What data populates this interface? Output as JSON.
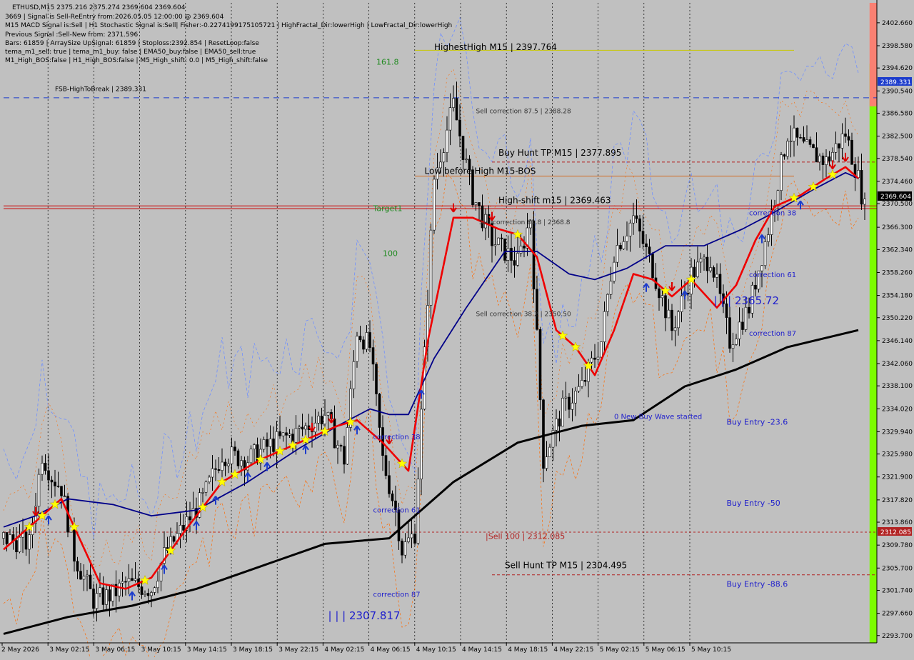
{
  "header": {
    "symbol": "ETHUSD,M15  2375.216 2375.274 2369.604 2369.604",
    "lines": [
      "3669 | Signal is Sell-ReEntry from:2026.05.05 12:00:00 @ 2369.604",
      "M15 MACD Signal is:Sell | H1 Stochastic Signal is:Sell| Fisher:-0.2274199175105721 | HighFractal_Dir:lowerHigh | LowFractal_Dir:lowerHigh",
      "Previous Signal :Sell-New from: 2371.596",
      "Bars: 61859 | ArraySize UpSignal: 61859 | Stoploss:2392.854 | ResetLoop:false",
      "tema_m1_sell: true | tema_m1_buy: false | EMA50_buy:false | EMA50_sell:true",
      "M1_High_BOS:false | H1_High_BOS:false | M5_High_shift: 0.0 | M5_High_shift:false"
    ]
  },
  "colors": {
    "background": "#c0c0c0",
    "grid": "#000000",
    "bull": "#ffffff",
    "bear": "#000000",
    "ema_fast": "#ee0000",
    "ema_mid": "#000088",
    "ema_slow": "#000000",
    "green_zone": "#7cfc00",
    "red_zone": "#fa8072",
    "blue_label": "#2020cc",
    "current_price_tag": "#000000",
    "blue_tag": "#1c3ccc",
    "red_tag": "#b22222"
  },
  "chart_data": {
    "type": "candlestick",
    "symbol": "ETHUSD",
    "timeframe": "M15",
    "ylim": [
      2292.4,
      2406.2
    ],
    "y_ticks": [
      "2402.660",
      "2398.580",
      "2394.620",
      "2390.540",
      "2386.580",
      "2382.500",
      "2378.540",
      "2374.460",
      "2370.500",
      "2366.300",
      "2362.340",
      "2358.260",
      "2354.180",
      "2350.220",
      "2346.140",
      "2342.060",
      "2338.100",
      "2334.020",
      "2329.940",
      "2325.980",
      "2321.900",
      "2317.820",
      "2313.860",
      "2309.780",
      "2305.700",
      "2301.740",
      "2297.660",
      "2293.700"
    ],
    "x_labels": [
      "2 May 2026",
      "3 May 02:15",
      "3 May 06:15",
      "3 May 10:15",
      "3 May 14:15",
      "3 May 18:15",
      "3 May 22:15",
      "4 May 02:15",
      "4 May 06:15",
      "4 May 10:15",
      "4 May 14:15",
      "4 May 18:15",
      "4 May 22:15",
      "5 May 02:15",
      "5 May 06:15",
      "5 May 10:15"
    ],
    "price_tags": {
      "current": "2369.604",
      "fsb": "2389.331",
      "sell_100": "2312.085"
    },
    "ohlc_anchors": [
      {
        "bar": 0,
        "close": 2311
      },
      {
        "bar": 8,
        "close": 2310
      },
      {
        "bar": 12,
        "close": 2326
      },
      {
        "bar": 15,
        "close": 2322
      },
      {
        "bar": 18,
        "close": 2320
      },
      {
        "bar": 22,
        "close": 2308
      },
      {
        "bar": 28,
        "close": 2300
      },
      {
        "bar": 34,
        "close": 2301
      },
      {
        "bar": 38,
        "close": 2303
      },
      {
        "bar": 46,
        "close": 2302
      },
      {
        "bar": 50,
        "close": 2308
      },
      {
        "bar": 56,
        "close": 2313
      },
      {
        "bar": 62,
        "close": 2318
      },
      {
        "bar": 68,
        "close": 2326
      },
      {
        "bar": 76,
        "close": 2325
      },
      {
        "bar": 84,
        "close": 2328
      },
      {
        "bar": 92,
        "close": 2330
      },
      {
        "bar": 100,
        "close": 2333
      },
      {
        "bar": 106,
        "close": 2325
      },
      {
        "bar": 110,
        "close": 2348
      },
      {
        "bar": 114,
        "close": 2345
      },
      {
        "bar": 118,
        "close": 2325
      },
      {
        "bar": 122,
        "close": 2316
      },
      {
        "bar": 124,
        "close": 2309
      },
      {
        "bar": 128,
        "close": 2312
      },
      {
        "bar": 134,
        "close": 2375
      },
      {
        "bar": 140,
        "close": 2388
      },
      {
        "bar": 146,
        "close": 2372
      },
      {
        "bar": 152,
        "close": 2364
      },
      {
        "bar": 160,
        "close": 2360
      },
      {
        "bar": 164,
        "close": 2368
      },
      {
        "bar": 168,
        "close": 2325
      },
      {
        "bar": 174,
        "close": 2334
      },
      {
        "bar": 180,
        "close": 2338
      },
      {
        "bar": 186,
        "close": 2346
      },
      {
        "bar": 190,
        "close": 2362
      },
      {
        "bar": 196,
        "close": 2368
      },
      {
        "bar": 202,
        "close": 2359
      },
      {
        "bar": 208,
        "close": 2348
      },
      {
        "bar": 214,
        "close": 2358
      },
      {
        "bar": 220,
        "close": 2361
      },
      {
        "bar": 226,
        "close": 2346
      },
      {
        "bar": 232,
        "close": 2352
      },
      {
        "bar": 238,
        "close": 2366
      },
      {
        "bar": 244,
        "close": 2383
      },
      {
        "bar": 250,
        "close": 2380
      },
      {
        "bar": 256,
        "close": 2378
      },
      {
        "bar": 262,
        "close": 2383
      },
      {
        "bar": 266,
        "close": 2375
      },
      {
        "bar": 268,
        "close": 2369.604
      }
    ],
    "ema_fast": [
      {
        "bar": 0,
        "v": 2309
      },
      {
        "bar": 10,
        "v": 2314
      },
      {
        "bar": 18,
        "v": 2318
      },
      {
        "bar": 30,
        "v": 2303
      },
      {
        "bar": 38,
        "v": 2302
      },
      {
        "bar": 46,
        "v": 2304
      },
      {
        "bar": 56,
        "v": 2312
      },
      {
        "bar": 68,
        "v": 2321
      },
      {
        "bar": 80,
        "v": 2325
      },
      {
        "bar": 92,
        "v": 2328
      },
      {
        "bar": 104,
        "v": 2331
      },
      {
        "bar": 110,
        "v": 2332
      },
      {
        "bar": 118,
        "v": 2328
      },
      {
        "bar": 126,
        "v": 2323
      },
      {
        "bar": 132,
        "v": 2346
      },
      {
        "bar": 140,
        "v": 2368
      },
      {
        "bar": 146,
        "v": 2368
      },
      {
        "bar": 154,
        "v": 2366
      },
      {
        "bar": 160,
        "v": 2365
      },
      {
        "bar": 166,
        "v": 2361
      },
      {
        "bar": 172,
        "v": 2348
      },
      {
        "bar": 178,
        "v": 2345
      },
      {
        "bar": 184,
        "v": 2340
      },
      {
        "bar": 190,
        "v": 2348
      },
      {
        "bar": 196,
        "v": 2358
      },
      {
        "bar": 202,
        "v": 2357
      },
      {
        "bar": 208,
        "v": 2354
      },
      {
        "bar": 214,
        "v": 2357
      },
      {
        "bar": 222,
        "v": 2352
      },
      {
        "bar": 228,
        "v": 2356
      },
      {
        "bar": 234,
        "v": 2364
      },
      {
        "bar": 240,
        "v": 2370
      },
      {
        "bar": 248,
        "v": 2372
      },
      {
        "bar": 256,
        "v": 2375
      },
      {
        "bar": 262,
        "v": 2377
      },
      {
        "bar": 266,
        "v": 2375
      }
    ],
    "ema_mid": [
      {
        "bar": 0,
        "v": 2313
      },
      {
        "bar": 10,
        "v": 2315
      },
      {
        "bar": 20,
        "v": 2318
      },
      {
        "bar": 34,
        "v": 2317
      },
      {
        "bar": 46,
        "v": 2315
      },
      {
        "bar": 60,
        "v": 2316
      },
      {
        "bar": 76,
        "v": 2321
      },
      {
        "bar": 92,
        "v": 2327
      },
      {
        "bar": 104,
        "v": 2331
      },
      {
        "bar": 114,
        "v": 2334
      },
      {
        "bar": 120,
        "v": 2333
      },
      {
        "bar": 126,
        "v": 2333
      },
      {
        "bar": 134,
        "v": 2343
      },
      {
        "bar": 144,
        "v": 2352
      },
      {
        "bar": 156,
        "v": 2362
      },
      {
        "bar": 166,
        "v": 2362
      },
      {
        "bar": 176,
        "v": 2358
      },
      {
        "bar": 184,
        "v": 2357
      },
      {
        "bar": 194,
        "v": 2359
      },
      {
        "bar": 206,
        "v": 2363
      },
      {
        "bar": 218,
        "v": 2363
      },
      {
        "bar": 230,
        "v": 2366
      },
      {
        "bar": 240,
        "v": 2369
      },
      {
        "bar": 252,
        "v": 2373
      },
      {
        "bar": 262,
        "v": 2376
      },
      {
        "bar": 266,
        "v": 2375
      }
    ],
    "ema_slow": [
      {
        "bar": 0,
        "v": 2294
      },
      {
        "bar": 20,
        "v": 2297
      },
      {
        "bar": 40,
        "v": 2299
      },
      {
        "bar": 60,
        "v": 2302
      },
      {
        "bar": 80,
        "v": 2306
      },
      {
        "bar": 100,
        "v": 2310
      },
      {
        "bar": 120,
        "v": 2311
      },
      {
        "bar": 140,
        "v": 2321
      },
      {
        "bar": 160,
        "v": 2328
      },
      {
        "bar": 180,
        "v": 2331
      },
      {
        "bar": 196,
        "v": 2332
      },
      {
        "bar": 212,
        "v": 2338
      },
      {
        "bar": 228,
        "v": 2341
      },
      {
        "bar": 244,
        "v": 2345
      },
      {
        "bar": 266,
        "v": 2348
      }
    ],
    "hlines": [
      {
        "name": "fsb-line",
        "y": 2389.331,
        "color": "#1c3ccc",
        "dash": "8,6",
        "from": 0,
        "to": 275
      },
      {
        "name": "current-price-line",
        "y": 2369.604,
        "color": "#cc0000",
        "dash": "",
        "from": 0,
        "to": 275
      },
      {
        "name": "current-price-line-2",
        "y": 2370.1,
        "color": "#cc0000",
        "dash": "",
        "from": 0,
        "to": 275
      },
      {
        "name": "sell-100-line",
        "y": 2312.085,
        "color": "#b22222",
        "dash": "3,3",
        "from": 0,
        "to": 275
      },
      {
        "name": "buy-hunt-line",
        "y": 2377.895,
        "color": "#b22222",
        "dash": "4,3",
        "from": 152,
        "to": 275
      },
      {
        "name": "sell-hunt-line",
        "y": 2304.495,
        "color": "#b22222",
        "dash": "4,3",
        "from": 152,
        "to": 275
      },
      {
        "name": "low-before-high-line",
        "y": 2375.4,
        "color": "#d2691e",
        "dash": "",
        "from": 128,
        "to": 246
      },
      {
        "name": "highest-high-line",
        "y": 2397.764,
        "color": "#c8c800",
        "dash": "",
        "from": 128,
        "to": 246
      }
    ],
    "zones": [
      {
        "name": "green-zone-left",
        "color": "#7cfc00",
        "x0": 154,
        "x1": 170,
        "y0": 2292.4,
        "y1": 2395.4
      },
      {
        "name": "red-zone-top",
        "color": "#fa8072",
        "x0": 154,
        "x1": 170,
        "y0": 2387.8,
        "y1": 2406.2
      },
      {
        "name": "green-zone-right",
        "color": "#7cfc00",
        "x0": 221,
        "x1": 239,
        "y0": 2349.2,
        "y1": 2406.2
      },
      {
        "name": "red-zone-bottom",
        "color": "#fa8072",
        "x0": 221,
        "x1": 239,
        "y0": 2292.4,
        "y1": 2349.2
      }
    ],
    "annotations": [
      {
        "name": "highest-high-label",
        "text": "HighestHigh   M15 | 2397.764",
        "bar": 134,
        "y": 2397.8,
        "color": "#000000",
        "size": 12
      },
      {
        "name": "fsb-label",
        "text": "FSB-HighToBreak | 2389.331",
        "bar": 16,
        "y": 2390.5,
        "color": "#000000",
        "size": 9
      },
      {
        "name": "sell-correction-875",
        "text": "Sell correction 87.5 | 2388.28",
        "bar": 147,
        "y": 2386.6,
        "color": "#333333",
        "size": 9
      },
      {
        "name": "buy-hunt-label",
        "text": "Buy Hunt  TP M15 | 2377.895",
        "bar": 154,
        "y": 2379.0,
        "color": "#000000",
        "size": 12
      },
      {
        "name": "low-before-high-label",
        "text": "Low before High   M15-BOS",
        "bar": 131,
        "y": 2375.8,
        "color": "#000000",
        "size": 12
      },
      {
        "name": "high-shift-label",
        "text": "High-shift m15 | 2369.463",
        "bar": 154,
        "y": 2370.6,
        "color": "#000000",
        "size": 12
      },
      {
        "name": "sell-correction-618",
        "text": "Sell correction 61.8 | 2368.8",
        "bar": 148,
        "y": 2366.8,
        "color": "#333333",
        "size": 9
      },
      {
        "name": "sell-correction-382",
        "text": "Sell correction 38.2 | 2350.50",
        "bar": 147,
        "y": 2350.5,
        "color": "#333333",
        "size": 9
      },
      {
        "name": "sell-100-label",
        "text": "|Sell 100 | 2312.085",
        "bar": 150,
        "y": 2310.9,
        "color": "#b22222",
        "size": 11
      },
      {
        "name": "sell-hunt-label",
        "text": "Sell Hunt  TP M15 | 2304.495",
        "bar": 156,
        "y": 2305.7,
        "color": "#000000",
        "size": 12
      },
      {
        "name": "target-label",
        "text": "Target1",
        "bar": 115,
        "y": 2369.2,
        "color": "#228b22",
        "size": 11
      },
      {
        "name": "fib-1618-label",
        "text": "161.8",
        "bar": 116,
        "y": 2395.2,
        "color": "#228b22",
        "size": 11
      },
      {
        "name": "fib-100-label",
        "text": "100",
        "bar": 118,
        "y": 2361.2,
        "color": "#228b22",
        "size": 11
      },
      {
        "name": "correction-38-a",
        "text": "correction 38",
        "bar": 115,
        "y": 2328.6,
        "color": "#2020cc",
        "size": 10
      },
      {
        "name": "correction-61-a",
        "text": "correction 61",
        "bar": 115,
        "y": 2315.6,
        "color": "#2020cc",
        "size": 10
      },
      {
        "name": "correction-87-a",
        "text": "correction 87",
        "bar": 115,
        "y": 2300.6,
        "color": "#2020cc",
        "size": 10
      },
      {
        "name": "level-2307817",
        "text": "| | | 2307.817",
        "bar": 101,
        "y": 2296.6,
        "color": "#2020cc",
        "size": 15
      },
      {
        "name": "correction-38-b",
        "text": "correction 38",
        "bar": 232,
        "y": 2368.4,
        "color": "#2020cc",
        "size": 10
      },
      {
        "name": "correction-61-b",
        "text": "correction 61",
        "bar": 232,
        "y": 2357.4,
        "color": "#2020cc",
        "size": 10
      },
      {
        "name": "correction-87-b",
        "text": "correction 87",
        "bar": 232,
        "y": 2347.0,
        "color": "#2020cc",
        "size": 10
      },
      {
        "name": "level-236572",
        "text": "| | | 2365.72",
        "bar": 221,
        "y": 2352.6,
        "color": "#2020cc",
        "size": 15
      },
      {
        "name": "new-buy-wave",
        "text": "0 New Buy Wave started",
        "bar": 190,
        "y": 2332.2,
        "color": "#2020cc",
        "size": 10
      },
      {
        "name": "buy-entry-236",
        "text": "Buy Entry -23.6",
        "bar": 225,
        "y": 2331.2,
        "color": "#2020cc",
        "size": 11
      },
      {
        "name": "buy-entry-50",
        "text": "Buy Entry -50",
        "bar": 225,
        "y": 2316.8,
        "color": "#2020cc",
        "size": 11
      },
      {
        "name": "buy-entry-886",
        "text": "Buy Entry -88.6",
        "bar": 225,
        "y": 2302.4,
        "color": "#2020cc",
        "size": 11
      }
    ],
    "grid": "vertical dotted",
    "legend": "none"
  }
}
